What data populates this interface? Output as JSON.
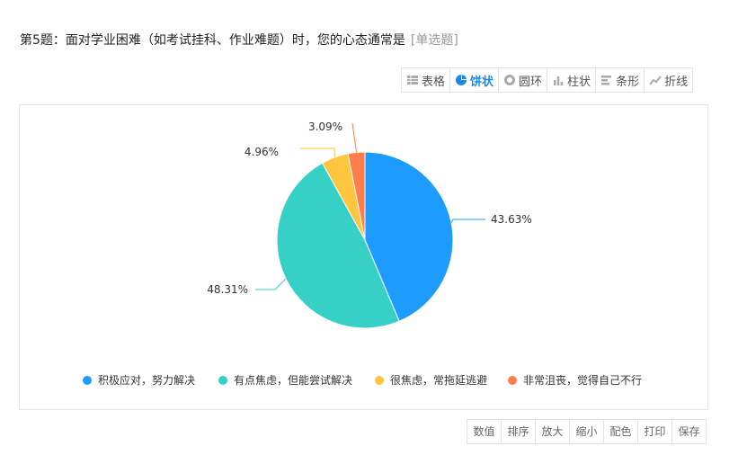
{
  "question": {
    "title": "第5题：面对学业困难（如考试挂科、作业难题）时，您的心态通常是",
    "tag": "[单选题]"
  },
  "toolbar": {
    "items": [
      {
        "label": "表格",
        "icon": "table-icon",
        "active": false
      },
      {
        "label": "饼状",
        "icon": "pie-icon",
        "active": true
      },
      {
        "label": "圆环",
        "icon": "donut-icon",
        "active": false
      },
      {
        "label": "柱状",
        "icon": "column-icon",
        "active": false
      },
      {
        "label": "条形",
        "icon": "bar-icon",
        "active": false
      },
      {
        "label": "折线",
        "icon": "line-icon",
        "active": false
      }
    ]
  },
  "bottom_bar": {
    "items": [
      "数值",
      "排序",
      "放大",
      "缩小",
      "配色",
      "打印",
      "保存"
    ]
  },
  "chart_data": {
    "type": "pie",
    "title": "",
    "legend_position": "bottom",
    "series": [
      {
        "name": "积极应对，努力解决",
        "value": 43.63,
        "label": "43.63%",
        "color": "#1e9bff"
      },
      {
        "name": "有点焦虑，但能尝试解决",
        "value": 48.31,
        "label": "48.31%",
        "color": "#36d0c6"
      },
      {
        "name": "很焦虑，常拖延逃避",
        "value": 4.96,
        "label": "4.96%",
        "color": "#ffc53d"
      },
      {
        "name": "非常沮丧，觉得自己不行",
        "value": 3.09,
        "label": "3.09%",
        "color": "#ff7d4d"
      }
    ]
  }
}
